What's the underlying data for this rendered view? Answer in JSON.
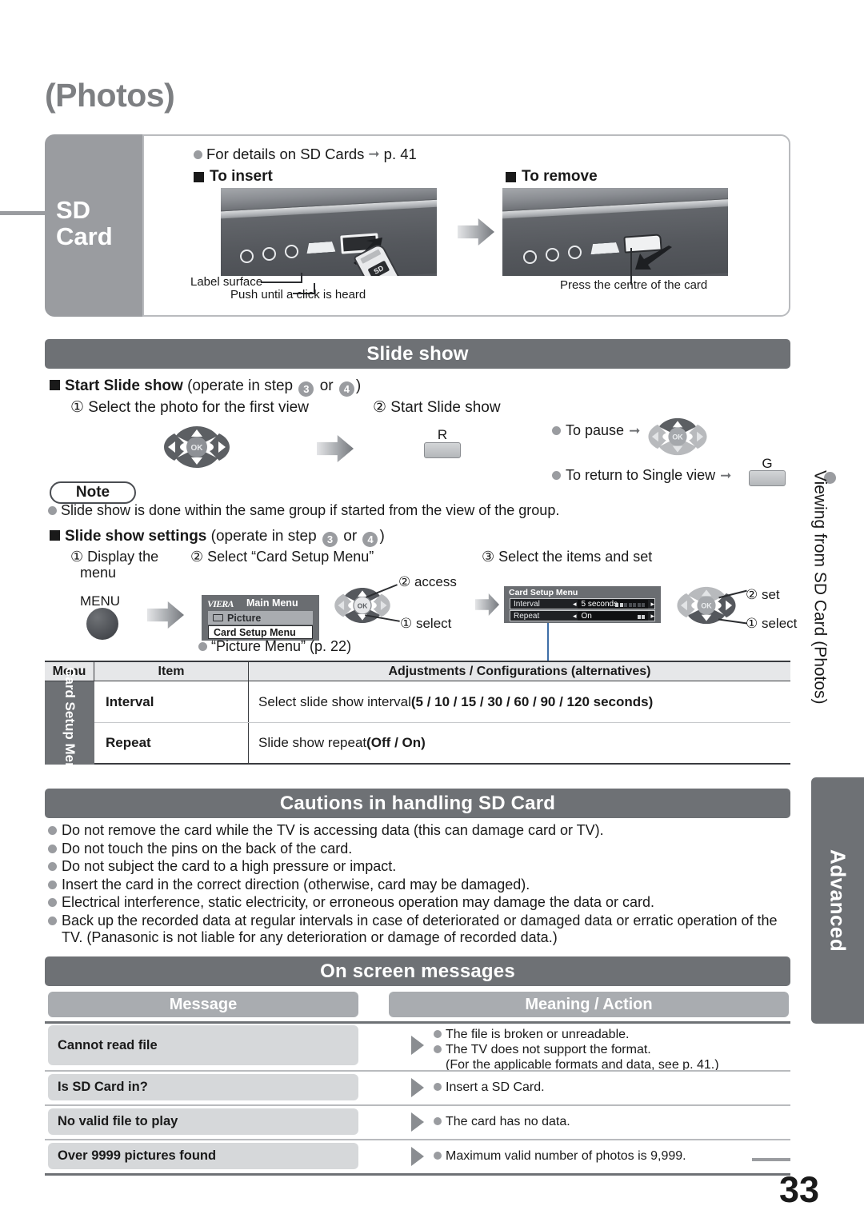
{
  "page": {
    "title": "(Photos)",
    "number": "33"
  },
  "sd_panel": {
    "badge_line1": "SD",
    "badge_line2": "Card",
    "note": "For details on SD Cards",
    "note_ref": "p. 41",
    "insert": {
      "heading": "To insert",
      "label_surface": "Label surface",
      "push_note": "Push until a click is heard"
    },
    "remove": {
      "heading": "To remove",
      "press_note": "Press the centre of the card"
    }
  },
  "slide_show": {
    "bar_title": "Slide show",
    "start": {
      "heading": "Start Slide show",
      "heading_suffix_pre": "(operate in step",
      "step_a": "3",
      "step_or": "or",
      "step_b": "4",
      "heading_suffix_post": ")",
      "step1": "① Select the photo for the first view",
      "step2": "② Start Slide show",
      "key_r": "R",
      "to_pause": "To pause",
      "to_return": "To return to Single view",
      "key_g": "G"
    },
    "note": {
      "label": "Note",
      "text": "Slide show is done within the same group if started from the view of the group."
    },
    "settings": {
      "heading": "Slide show settings",
      "heading_suffix_pre": "(operate in step",
      "step_a": "3",
      "step_or": "or",
      "step_b": "4",
      "heading_suffix_post": ")",
      "step1_l1": "① Display the",
      "step1_l2": "menu",
      "step2": "② Select “Card Setup Menu”",
      "step3": "③ Select the items and set",
      "menu_button": "MENU",
      "picture_menu_ref": "“Picture Menu” (p. 22)",
      "osd_main": {
        "brand": "VIERA",
        "title": "Main Menu",
        "item_picture": "Picture",
        "item_card_setup": "Card Setup Menu"
      },
      "osd_card": {
        "title": "Card Setup Menu",
        "rows": [
          {
            "name": "Interval",
            "value": "5 seconds"
          },
          {
            "name": "Repeat",
            "value": "On"
          }
        ]
      },
      "dpad_left": {
        "access": "② access",
        "select": "① select"
      },
      "dpad_right": {
        "set": "② set",
        "select": "① select"
      }
    }
  },
  "settings_table": {
    "headers": [
      "Menu",
      "Item",
      "Adjustments / Configurations (alternatives)"
    ],
    "menu_label": "Card Setup Menu",
    "rows": [
      {
        "item": "Interval",
        "desc_plain": "Select slide show interval ",
        "desc_bold": "(5 / 10 / 15 / 30 / 60 / 90 / 120 seconds)"
      },
      {
        "item": "Repeat",
        "desc_plain": "Slide show repeat ",
        "desc_bold": "(Off / On)"
      }
    ]
  },
  "cautions": {
    "bar_title": "Cautions in handling SD Card",
    "items": [
      "Do not remove the card while the TV is accessing data (this can damage card or TV).",
      "Do not touch the pins on the back of the card.",
      "Do not subject the card to a high pressure or impact.",
      "Insert the card in the correct direction (otherwise, card may be damaged).",
      "Electrical interference, static electricity, or erroneous operation may damage the data or card.",
      "Back up the recorded data at regular intervals in case of deteriorated or damaged data or erratic operation of the TV. (Panasonic is not liable for any deterioration or damage of recorded data.)"
    ]
  },
  "on_screen_messages": {
    "bar_title": "On screen messages",
    "col_message": "Message",
    "col_meaning": "Meaning / Action",
    "rows": [
      {
        "message": "Cannot read file",
        "meanings": [
          "The file is broken or unreadable.",
          "The TV does not support the format."
        ],
        "sub": "(For the applicable formats and data, see p. 41.)"
      },
      {
        "message": "Is SD Card in?",
        "meanings": [
          "Insert a SD Card."
        ],
        "sub": ""
      },
      {
        "message": "No valid file to play",
        "meanings": [
          "The card has no data."
        ],
        "sub": ""
      },
      {
        "message": "Over 9999 pictures found",
        "meanings": [
          "Maximum valid number of photos is 9,999."
        ],
        "sub": ""
      }
    ]
  },
  "side_tab": {
    "chapter": "Viewing from SD Card (Photos)",
    "section": "Advanced"
  },
  "colors": {
    "bar_gray": "#6e7175",
    "badge_gray": "#9a9ca0",
    "light_gray": "#d6d8da",
    "head_gray": "#a9acb0"
  }
}
